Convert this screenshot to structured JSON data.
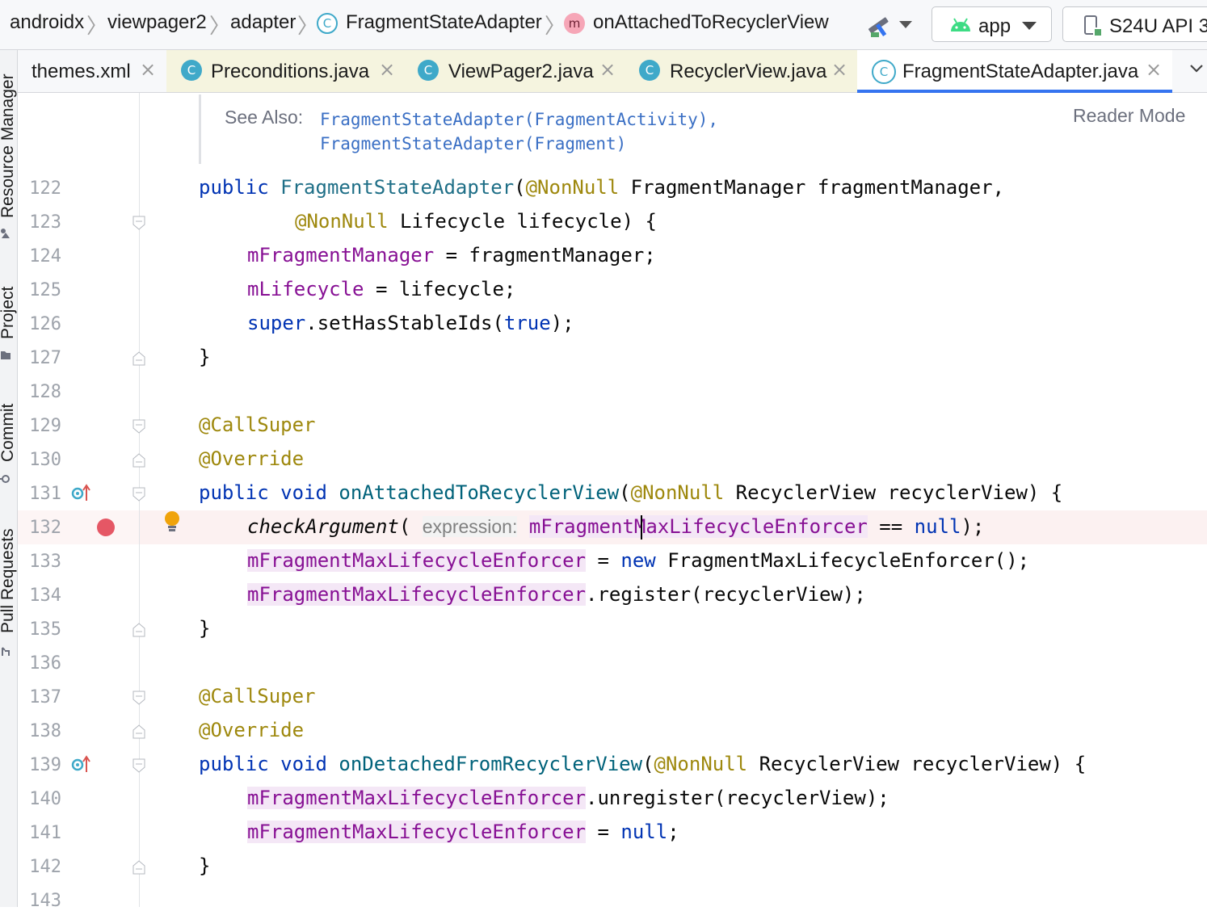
{
  "breadcrumb": {
    "items": [
      "androidx",
      "viewpager2",
      "adapter",
      "FragmentStateAdapter",
      "onAttachedToRecyclerView"
    ],
    "class_icon_letter": "C",
    "method_icon_letter": "m"
  },
  "toolbar": {
    "run_config": "app",
    "device": "S24U API 3"
  },
  "tabs": [
    {
      "label": "themes.xml",
      "icon": "xml-file-icon"
    },
    {
      "label": "Preconditions.java",
      "icon": "class-icon"
    },
    {
      "label": "ViewPager2.java",
      "icon": "class-icon"
    },
    {
      "label": "RecyclerView.java",
      "icon": "class-icon"
    },
    {
      "label": "FragmentStateAdapter.java",
      "icon": "abstract-class-icon",
      "active": true
    }
  ],
  "tab_close_glyph": "×",
  "tab_icon_letter": "C",
  "tool_windows": [
    "Resource Manager",
    "Project",
    "Commit",
    "Pull Requests"
  ],
  "doc": {
    "see_also_label": "See Also:",
    "links": [
      "FragmentStateAdapter(FragmentActivity),",
      "FragmentStateAdapter(Fragment)"
    ],
    "reader_mode": "Reader Mode"
  },
  "line_numbers": [
    "122",
    "123",
    "124",
    "125",
    "126",
    "127",
    "128",
    "129",
    "130",
    "131",
    "132",
    "133",
    "134",
    "135",
    "136",
    "137",
    "138",
    "139",
    "140",
    "141",
    "142",
    "143"
  ],
  "code": {
    "l122": {
      "kw": "public",
      "type": "FragmentStateAdapter",
      "p": "(",
      "ann": "@NonNull",
      "rest": " FragmentManager fragmentManager,"
    },
    "l123": {
      "ann": "@NonNull",
      "rest": " Lifecycle lifecycle) {"
    },
    "l124": {
      "field": "mFragmentManager",
      "rest": " = fragmentManager;"
    },
    "l125": {
      "field": "mLifecycle",
      "rest": " = lifecycle;"
    },
    "l126": {
      "kw": "super",
      "mid": ".setHasStableIds(",
      "kw2": "true",
      "rest": ");"
    },
    "l127": {
      "rest": "}"
    },
    "l129": {
      "ann": "@CallSuper"
    },
    "l130": {
      "ann": "@Override"
    },
    "l131": {
      "kw": "public void ",
      "fn": "onAttachedToRecyclerView",
      "p": "(",
      "ann": "@NonNull",
      "rest": " RecyclerView recyclerView) {"
    },
    "l132": {
      "call": "checkArgument",
      "p": "( ",
      "hint": "expression:",
      "field": "mFragmentMaxLifecycleEnforcer",
      "mid": " == ",
      "kw": "null",
      "rest": ");"
    },
    "l133": {
      "field": "mFragmentMaxLifecycleEnforcer",
      "mid": " = ",
      "kw": "new",
      "rest": " FragmentMaxLifecycleEnforcer();"
    },
    "l134": {
      "field": "mFragmentMaxLifecycleEnforcer",
      "rest": ".register(recyclerView);"
    },
    "l135": {
      "rest": "}"
    },
    "l137": {
      "ann": "@CallSuper"
    },
    "l138": {
      "ann": "@Override"
    },
    "l139": {
      "kw": "public void ",
      "fn": "onDetachedFromRecyclerView",
      "p": "(",
      "ann": "@NonNull",
      "rest": " RecyclerView recyclerView) {"
    },
    "l140": {
      "field": "mFragmentMaxLifecycleEnforcer",
      "rest": ".unregister(recyclerView);"
    },
    "l141": {
      "field": "mFragmentMaxLifecycleEnforcer",
      "mid": " = ",
      "kw": "null",
      "rest": ";"
    },
    "l142": {
      "rest": "}"
    }
  },
  "colors": {
    "accent": "#3574f0",
    "breakpoint": "#e55765",
    "keyword": "#0033b3",
    "annotation": "#9e880d",
    "field": "#871094"
  }
}
